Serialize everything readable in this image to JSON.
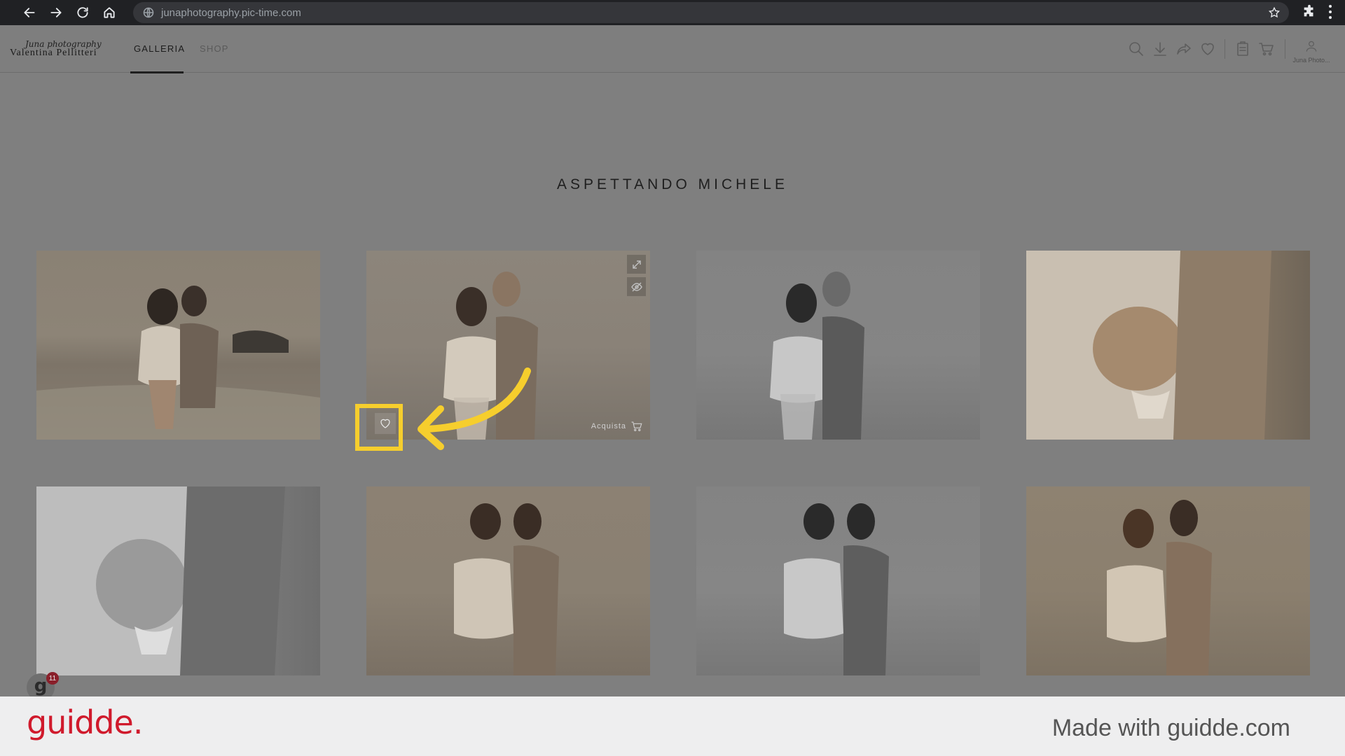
{
  "browser": {
    "url": "junaphotography.pic-time.com"
  },
  "header": {
    "logo_script": "Juna photography",
    "logo_name": "Valentina Pellitteri",
    "tabs": [
      {
        "label": "GALLERIA",
        "active": true
      },
      {
        "label": "SHOP",
        "active": false
      }
    ],
    "account_label": "Juna Photo..."
  },
  "gallery": {
    "title": "ASPETTANDO MICHELE",
    "hovered_photo": {
      "buy_label": "Acquista"
    }
  },
  "overlay": {
    "avatar_letter": "g",
    "badge_count": "11"
  },
  "footer": {
    "brand": "guidde.",
    "made_with": "Made with guidde.com"
  },
  "colors": {
    "highlight": "#f6ce2d",
    "brand_red": "#d01a2c",
    "dim_overlay": "#7f7f7f"
  }
}
